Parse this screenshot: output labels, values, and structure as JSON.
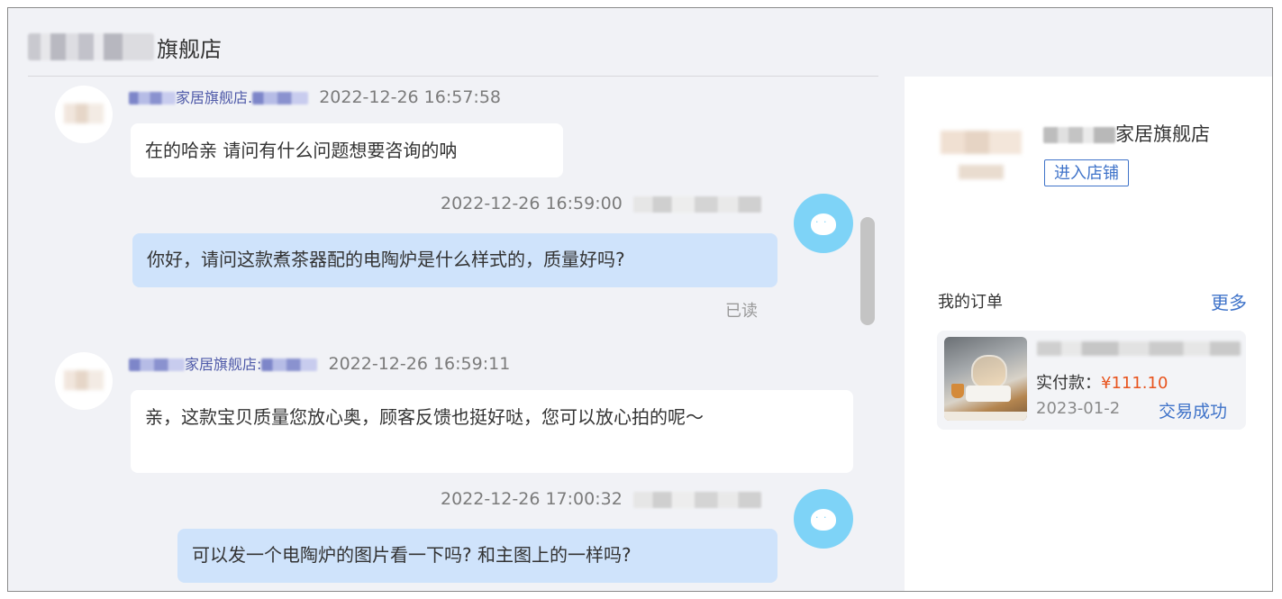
{
  "header": {
    "title_suffix": "旗舰店"
  },
  "messages": [
    {
      "sender_suffix": "家居旗舰店",
      "time": "2022-12-26 16:57:58",
      "text": "在的哈亲 请问有什么问题想要咨询的呐"
    },
    {
      "time": "2022-12-26 16:59:00",
      "text": "你好，请问这款煮茶器配的电陶炉是什么样式的，质量好吗?",
      "status": "已读"
    },
    {
      "sender_suffix": "家居旗舰店",
      "time": "2022-12-26 16:59:11",
      "text": "亲，这款宝贝质量您放心奥，顾客反馈也挺好哒，您可以放心拍的呢～"
    },
    {
      "time": "2022-12-26 17:00:32",
      "text": "可以发一个电陶炉的图片看一下吗? 和主图上的一样吗?"
    }
  ],
  "sidebar": {
    "shop_name_suffix": "家居旗舰店",
    "enter_button": "进入店铺",
    "orders_title": "我的订单",
    "more_link": "更多",
    "order": {
      "price_label": "实付款：",
      "price": "¥111.10",
      "date": "2023-01-2",
      "status": "交易成功"
    }
  }
}
